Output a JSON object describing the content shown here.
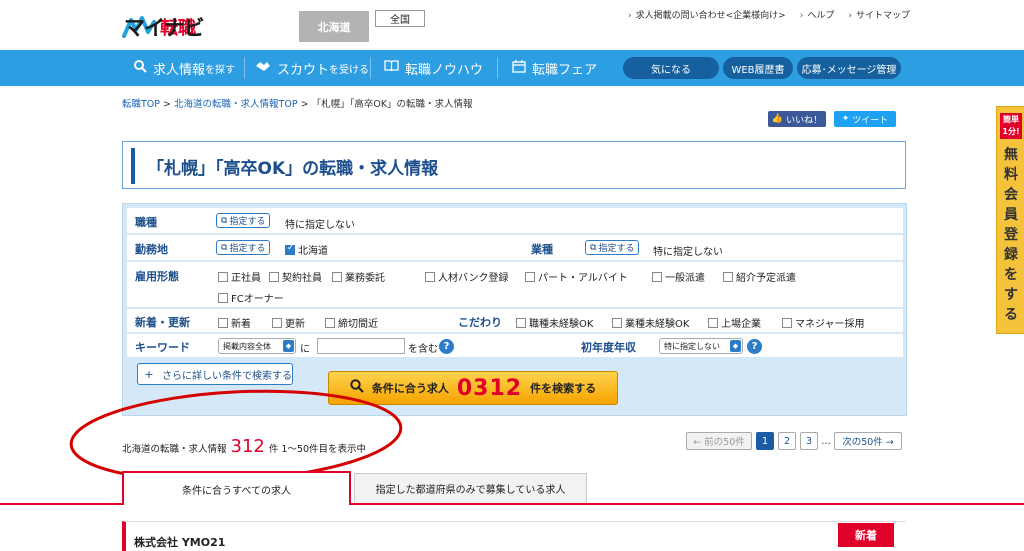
{
  "header": {
    "logo_text": "マイナビ",
    "logo_sub": "転職",
    "region_button": "北海道",
    "all_button": "全国",
    "links": [
      "求人掲載の問い合わせ<企業様向け>",
      "ヘルプ",
      "サイトマップ"
    ]
  },
  "nav": {
    "items": [
      {
        "label": "求人情報",
        "suffix": "を探す",
        "icon": "search-icon"
      },
      {
        "label": "スカウト",
        "suffix": "を受ける",
        "icon": "handshake-icon"
      },
      {
        "label": "転職ノウハウ",
        "suffix": "",
        "icon": "book-icon"
      },
      {
        "label": "転職フェア",
        "suffix": "",
        "icon": "calendar-icon"
      }
    ],
    "pills": [
      "気になる",
      "WEB履歴書",
      "応募･メッセージ管理"
    ]
  },
  "breadcrumb": {
    "items": [
      "転職TOP",
      "北海道の転職・求人情報TOP",
      "「札幌」「高卒OK」の転職・求人情報"
    ],
    "separator": ">"
  },
  "social": {
    "like": "いいね！",
    "tweet": "ツイート"
  },
  "side_tab": {
    "badge_top": "簡単",
    "badge_bottom": "1分!",
    "label": "無料会員登録をする"
  },
  "title": "「札幌」「高卒OK」の転職・求人情報",
  "search": {
    "pick_label": "指定する",
    "job_type": {
      "label": "職種",
      "value": "特に指定しない"
    },
    "location": {
      "label": "勤務地",
      "value": "北海道"
    },
    "industry": {
      "label": "業種",
      "value": "特に指定しない"
    },
    "employment": {
      "label": "雇用形態",
      "options": [
        "正社員",
        "契約社員",
        "業務委託",
        "人材バンク登録",
        "パート・アルバイト",
        "一般派遣",
        "紹介予定派遣",
        "FCオーナー"
      ]
    },
    "new": {
      "label": "新着・更新",
      "options": [
        "新着",
        "更新",
        "締切間近"
      ]
    },
    "kodawari": {
      "label": "こだわり",
      "options": [
        "職種未経験OK",
        "業種未経験OK",
        "上場企業",
        "マネジャー採用"
      ]
    },
    "keyword": {
      "label": "キーワード",
      "select": "掲載内容全体",
      "ni": "に",
      "wo_fukumu": "を含む"
    },
    "salary": {
      "label": "初年度年収",
      "select": "特に指定しない"
    },
    "detail_button": "さらに詳しい条件で検索する",
    "submit": {
      "prefix": "条件に合う求人",
      "count": "0312",
      "suffix": "件を検索する"
    }
  },
  "results": {
    "prefix": "北海道の転職・求人情報",
    "count": "312",
    "suffix": "件 1〜50件目を表示中"
  },
  "pager": {
    "prev": "← 前の50件",
    "pages": [
      "1",
      "2",
      "3"
    ],
    "dots": "…",
    "next": "次の50件 →"
  },
  "tabs": [
    "条件に合うすべての求人",
    "指定した都道府県のみで募集している求人"
  ],
  "listing": {
    "company": "株式会社 YMO21",
    "tag": "新着"
  },
  "colors": {
    "brand_red": "#e0002a",
    "nav_blue": "#2d9ee2",
    "title_blue": "#1d4f8c",
    "annotation": "#d40000"
  }
}
